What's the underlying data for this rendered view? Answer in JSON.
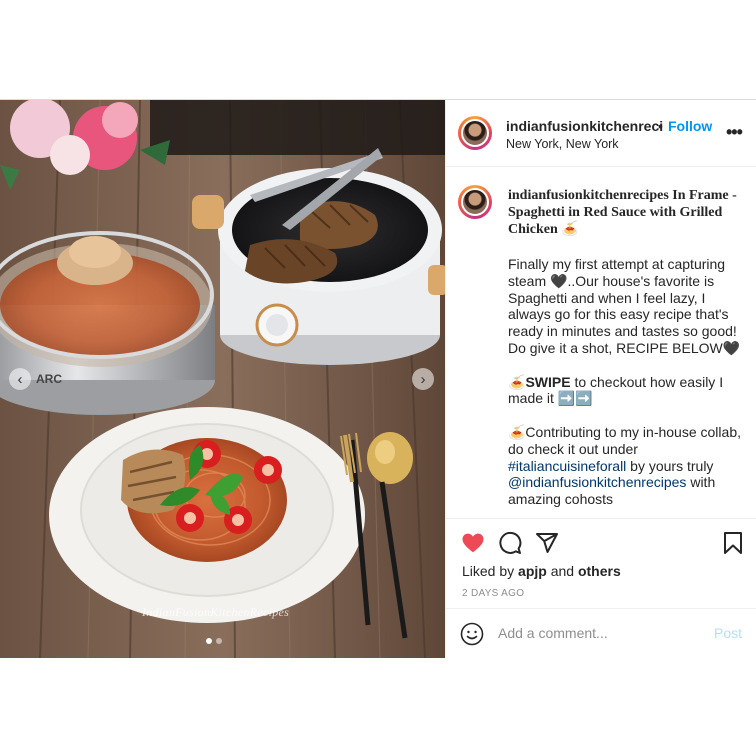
{
  "post": {
    "username": "indianfusionkitchenreci",
    "separator": "•",
    "follow_label": "Follow",
    "location": "New York, New York",
    "more_label": "•••",
    "watermark": "IndianFusionKitchenRecipes",
    "caption": {
      "title": "indianfusionkitchenrecipes In Frame - Spaghetti in Red Sauce with Grilled Chicken 🍝",
      "p1": "Finally my first attempt at capturing steam 🖤..Our house's favorite is Spaghetti and when I feel lazy, I always go for this easy recipe that's ready in minutes and tastes so good! Do give it a shot, RECIPE BELOW🖤",
      "p2_prefix": "🍝",
      "p2_bold": "SWIPE",
      "p2_rest": " to checkout how easily I made it ➡️➡️",
      "p3_prefix": "🍝Contributing to my in-house collab, do check it out under ",
      "hashtag": "#italiancuisineforall",
      "p3_mid": " by yours truly ",
      "mention": "@indianfusionkitchenrecipes",
      "p3_end": " with amazing cohosts"
    },
    "likes": {
      "prefix": "Liked by ",
      "user": "apjp",
      "and": " and ",
      "others": "others"
    },
    "timestamp": "2 DAYS AGO",
    "comment_placeholder": "Add a comment...",
    "post_label": "Post",
    "nav": {
      "prev": "‹",
      "next": "›"
    },
    "carousel_dots": 2,
    "active_dot": 1
  },
  "colors": {
    "accent": "#0095f6",
    "heart": "#ed4956",
    "muted": "#8e8e8e",
    "link": "#00376b"
  },
  "icons": [
    "heart-icon",
    "comment-icon",
    "share-icon",
    "bookmark-icon",
    "smile-icon",
    "chevron-left-icon",
    "chevron-right-icon"
  ]
}
